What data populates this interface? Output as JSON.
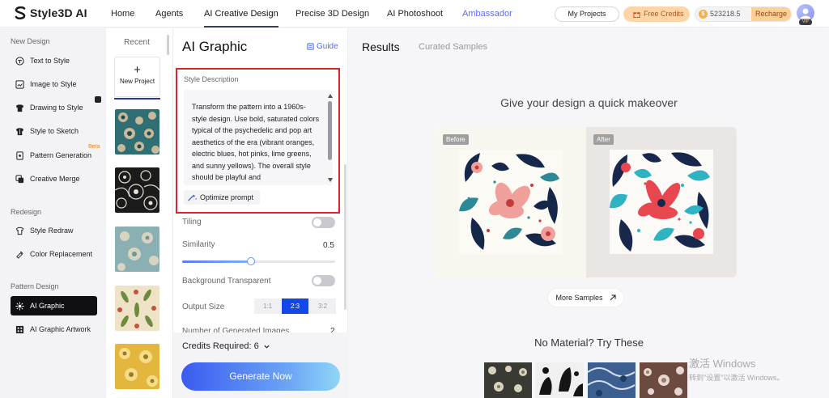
{
  "brand": {
    "name": "Style3D AI"
  },
  "nav": {
    "items": [
      "Home",
      "Agents",
      "AI Creative Design",
      "Precise 3D Design",
      "AI Photoshoot",
      "Ambassador"
    ],
    "my_projects": "My Projects",
    "free_credits": "Free Credits",
    "balance": "523218.5",
    "recharge": "Recharge",
    "vip": "VIP"
  },
  "sidebar": {
    "sections": [
      "New Design",
      "Redesign",
      "Pattern Design"
    ],
    "items": [
      {
        "label": "Text to Style",
        "icon": "shirt-text-icon"
      },
      {
        "label": "Image to Style",
        "icon": "image-shirt-icon"
      },
      {
        "label": "Drawing to Style",
        "icon": "drawing-shirt-icon"
      },
      {
        "label": "Style to Sketch",
        "icon": "sketch-icon"
      },
      {
        "label": "Pattern Generation",
        "icon": "pattern-icon"
      },
      {
        "label": "Creative Merge",
        "icon": "merge-icon"
      },
      {
        "label": "Style Redraw",
        "icon": "redraw-icon"
      },
      {
        "label": "Color Replacement",
        "icon": "color-icon"
      },
      {
        "label": "AI Graphic",
        "icon": "graphic-icon"
      },
      {
        "label": "AI Graphic Artwork",
        "icon": "artwork-icon"
      }
    ],
    "beta": "Beta"
  },
  "recent": {
    "title": "Recent",
    "new_project": "New Project",
    "thumbnails": [
      {
        "colors": [
          "#2f6f74",
          "#c7b99a",
          "#1f4c52"
        ]
      },
      {
        "colors": [
          "#1b1b1b",
          "#e8e2d4",
          "#555555"
        ]
      },
      {
        "colors": [
          "#8ab0b3",
          "#e4dcc2",
          "#6f9598"
        ]
      },
      {
        "colors": [
          "#efe3c7",
          "#c6523b",
          "#6e8a3c"
        ]
      },
      {
        "colors": [
          "#e3b63d",
          "#f5dc8a",
          "#9c7a1d"
        ]
      }
    ]
  },
  "panel": {
    "title": "AI Graphic",
    "guide": "Guide",
    "style_description_label": "Style Description",
    "style_description": "Transform the pattern into a 1960s-style design. Use bold, saturated colors typical of the psychedelic and pop art aesthetics of the era (vibrant oranges, electric blues, hot pinks, lime greens, and sunny yellows). The overall style should be playful and",
    "optimize_prompt": "Optimize prompt",
    "tiling_label": "Tiling",
    "tiling_on": false,
    "similarity_label": "Similarity",
    "similarity_value": "0.5",
    "similarity_fraction": 0.45,
    "background_label": "Background Transparent",
    "background_on": false,
    "output_size_label": "Output Size",
    "output_sizes": [
      "1:1",
      "2:3",
      "3:2"
    ],
    "output_size_selected": "2:3",
    "generated_label": "Number of Generated Images",
    "generated_value": "2",
    "credits_required": "Credits Required: 6",
    "generate": "Generate Now"
  },
  "results": {
    "tab_results": "Results",
    "tab_curated": "Curated Samples",
    "makeover_title": "Give your design a quick makeover",
    "before": "Before",
    "after": "After",
    "more_samples": "More Samples",
    "no_material": "No Material? Try These",
    "materials": [
      {
        "colors": [
          "#3a3a34",
          "#d9d2bd",
          "#7a7460"
        ]
      },
      {
        "colors": [
          "#151515",
          "#f0f0f0",
          "#555555"
        ]
      },
      {
        "colors": [
          "#3d5f8f",
          "#d6dfee",
          "#1f3b66"
        ]
      },
      {
        "colors": [
          "#6d4a3f",
          "#e6d8d0",
          "#a07a6c"
        ]
      }
    ]
  },
  "watermark": {
    "line1": "激活 Windows",
    "line2": "转到\"设置\"以激活 Windows。"
  },
  "colors": {
    "accent": "#1248e8",
    "highlight_border": "#d9262b",
    "active_sidebar": "#101014"
  }
}
